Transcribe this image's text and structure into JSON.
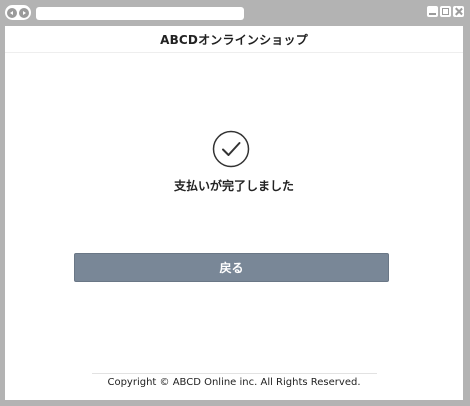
{
  "header": {
    "title": "ABCDオンラインショップ"
  },
  "main": {
    "status_icon": "check-circle-icon",
    "message": "支払いが完了しました",
    "back_button_label": "戻る"
  },
  "footer": {
    "copyright": "Copyright © ABCD Online inc. All Rights Reserved."
  },
  "colors": {
    "button_background": "#798797",
    "window_frame": "#b3b3b3",
    "text": "#222222"
  }
}
